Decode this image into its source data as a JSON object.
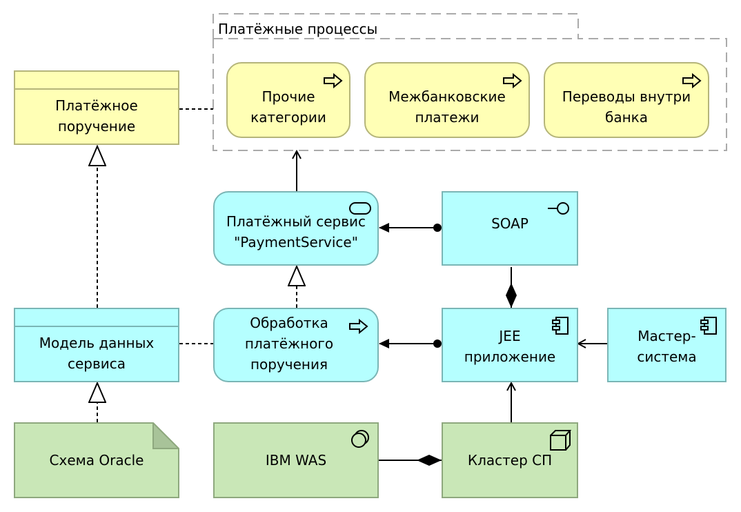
{
  "diagram": {
    "group": {
      "label": "Платёжные процессы"
    },
    "business_processes": [
      {
        "id": "other",
        "label": "Прочие\nкатегории",
        "icon": "process-arrow-icon"
      },
      {
        "id": "interbank",
        "label": "Межбанковские\nплатежи",
        "icon": "process-arrow-icon"
      },
      {
        "id": "intrabank",
        "label": "Переводы внутри\nбанка",
        "icon": "process-arrow-icon"
      }
    ],
    "business_object": {
      "label": "Платёжное\nпоручение"
    },
    "app_service": {
      "label": "Платёжный сервис\n\"PaymentService\"",
      "icon": "service-icon"
    },
    "app_interface": {
      "label": "SOAP",
      "icon": "interface-icon"
    },
    "app_process": {
      "label": "Обработка\nплатёжного\nпоручения",
      "icon": "process-arrow-icon"
    },
    "app_component_jee": {
      "label": "JEE\nприложение",
      "icon": "component-icon"
    },
    "app_component_master": {
      "label": "Мастер-\nсистема",
      "icon": "component-icon"
    },
    "data_object": {
      "label": "Модель данных\nсервиса"
    },
    "artifact": {
      "label": "Схема Oracle"
    },
    "system_software": {
      "label": "IBM WAS",
      "icon": "system-software-icon"
    },
    "node": {
      "label": "Кластер СП",
      "icon": "node-icon"
    },
    "colors": {
      "business_fill": "#ffffb5",
      "application_fill": "#b5ffff",
      "technology_fill": "#c9e7b7"
    }
  }
}
